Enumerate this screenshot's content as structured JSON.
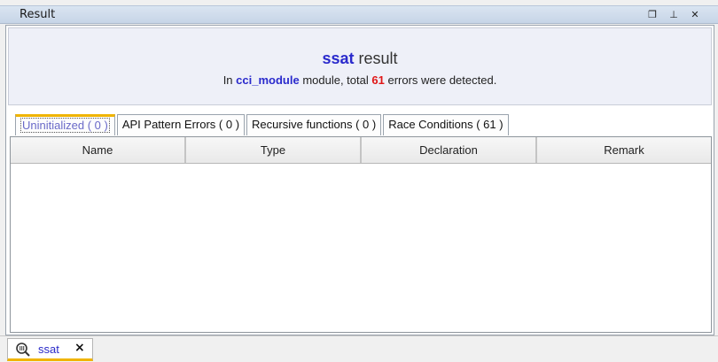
{
  "window": {
    "title": "Result"
  },
  "summary": {
    "tool_name": "ssat",
    "title_suffix": "result",
    "msg_prefix": "In",
    "module_name": "cci_module",
    "msg_middle": "module, total",
    "error_count": "61",
    "msg_suffix": "errors were detected."
  },
  "tabs": [
    {
      "label": "Uninitialized ( 0 )",
      "active": true
    },
    {
      "label": "API Pattern Errors ( 0 )",
      "active": false
    },
    {
      "label": "Recursive functions ( 0 )",
      "active": false
    },
    {
      "label": "Race Conditions ( 61 )",
      "active": false
    }
  ],
  "table": {
    "columns": [
      "Name",
      "Type",
      "Declaration",
      "Remark"
    ],
    "rows": []
  },
  "bottom_tab": {
    "label": "ssat",
    "close": "×"
  },
  "titlebar_controls": {
    "restore": "❐",
    "pin": "⊥",
    "close": "✕"
  },
  "colors": {
    "accent_blue": "#2a2acc",
    "error_red": "#e01818",
    "tab_highlight": "#f0b400"
  },
  "icons": {
    "bottom_tab": "magnifier-icon"
  }
}
